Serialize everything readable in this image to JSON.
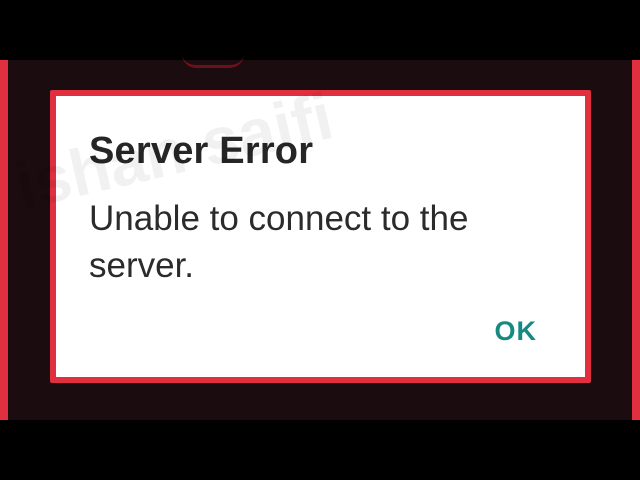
{
  "dialog": {
    "title": "Server Error",
    "message": "Unable to connect to the server.",
    "ok_label": "OK"
  },
  "watermark": {
    "text": "ishan saifi"
  },
  "colors": {
    "frame_accent": "#e0303f",
    "button_text": "#168a80",
    "backdrop": "#1a0c0f"
  }
}
